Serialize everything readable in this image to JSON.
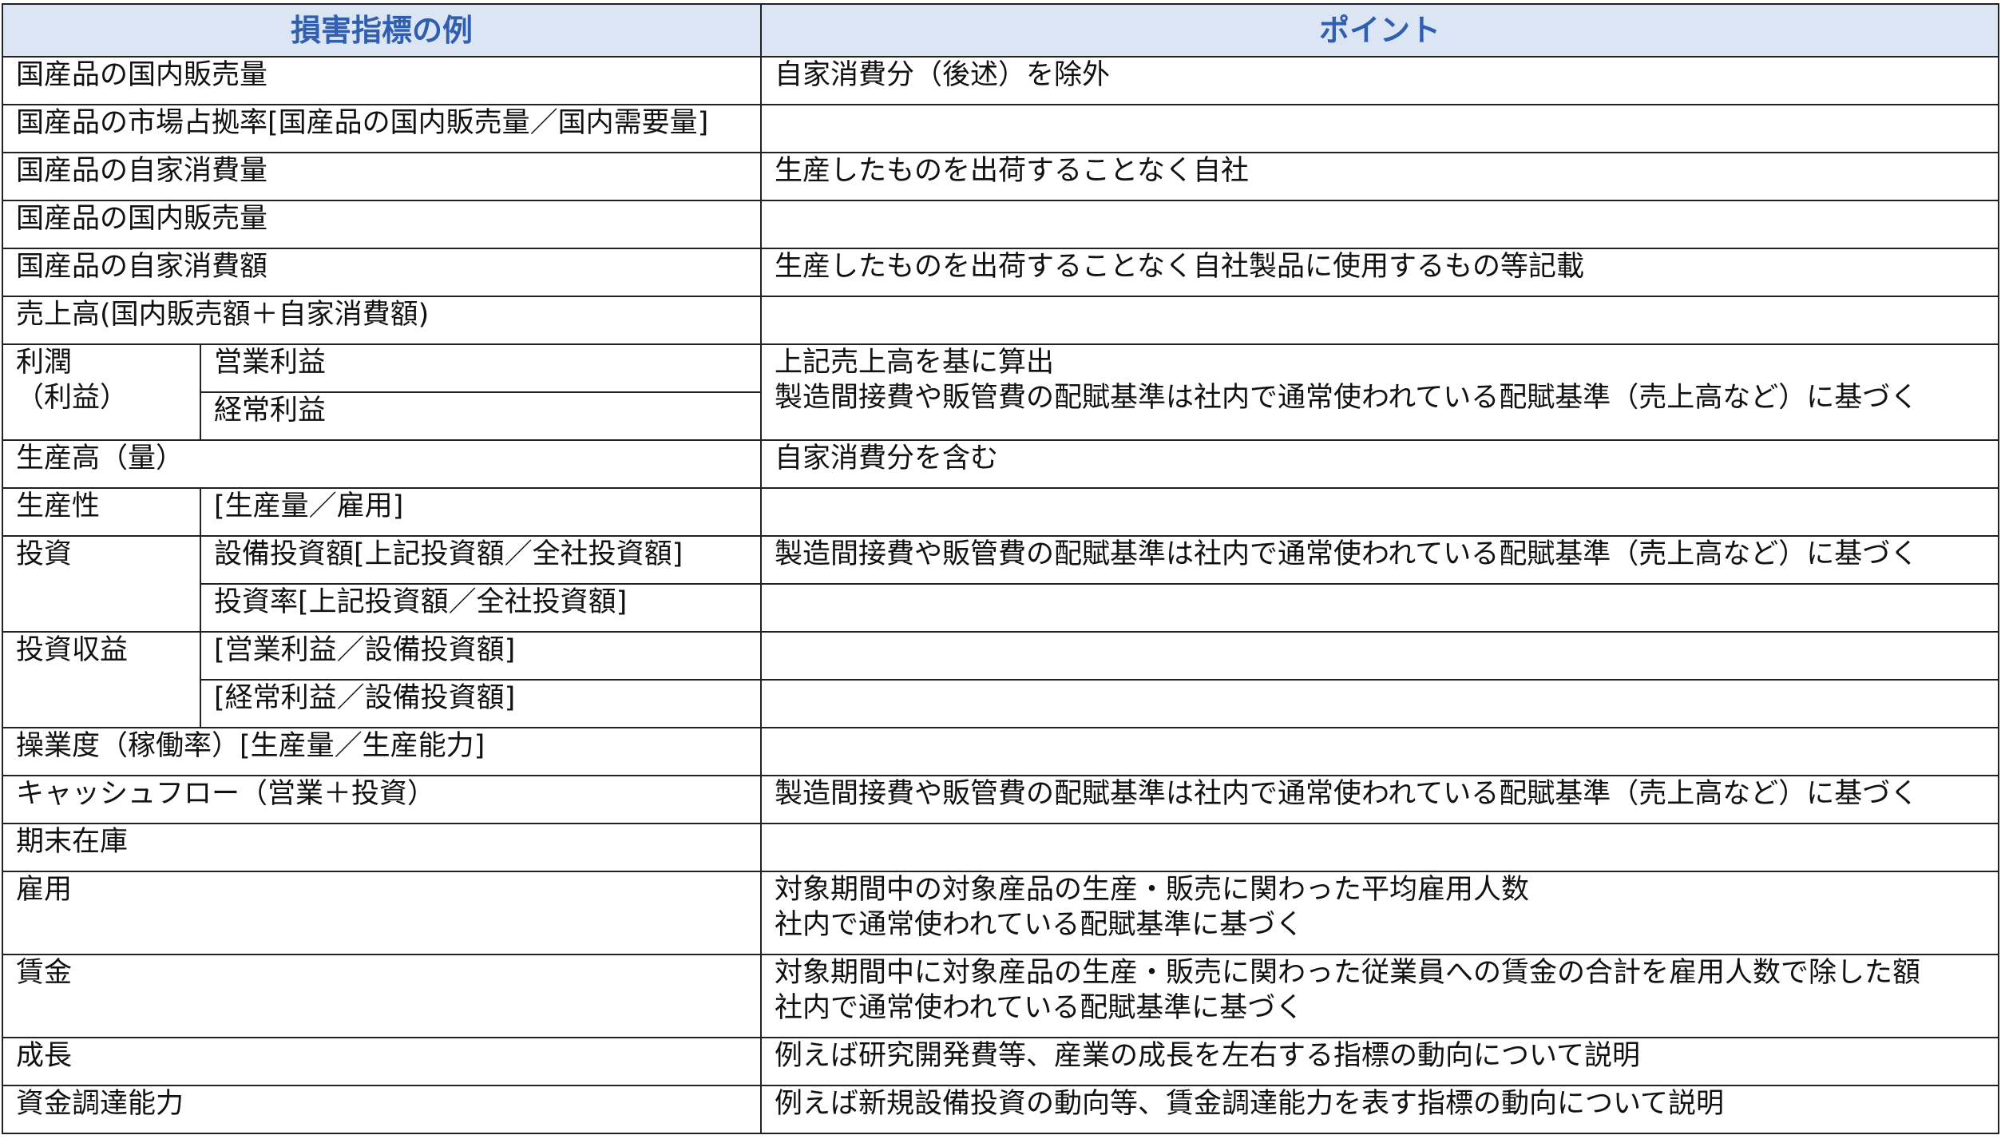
{
  "header": {
    "col_indicator": "損害指標の例",
    "col_point": "ポイント"
  },
  "rows": {
    "domestic_sales_volume": {
      "label": "国産品の国内販売量",
      "point": "自家消費分（後述）を除外"
    },
    "market_share": {
      "label": "国産品の市場占拠率[国産品の国内販売量／国内需要量]",
      "point": ""
    },
    "self_consumption_volume": {
      "label": "国産品の自家消費量",
      "point": "生産したものを出荷することなく自社"
    },
    "domestic_sales_volume_2": {
      "label": "国産品の国内販売量",
      "point": ""
    },
    "self_consumption_amount": {
      "label": "国産品の自家消費額",
      "point": "生産したものを出荷することなく自社製品に使用するもの等記載"
    },
    "sales_total": {
      "label": "売上高(国内販売額＋自家消費額)",
      "point": ""
    },
    "profit": {
      "label_line1": "利潤",
      "label_line2": "（利益）",
      "sub1": "営業利益",
      "sub2": "経常利益",
      "point_line1": "上記売上高を基に算出",
      "point_line2": "製造間接費や販管費の配賦基準は社内で通常使われている配賦基準（売上高など）に基づく"
    },
    "production_output": {
      "label": "生産高（量）",
      "point": "自家消費分を含む"
    },
    "productivity": {
      "label": "生産性",
      "sub": "[生産量／雇用]",
      "point": ""
    },
    "investment": {
      "label": "投資",
      "sub1": "設備投資額[上記投資額／全社投資額]",
      "point1": "製造間接費や販管費の配賦基準は社内で通常使われている配賦基準（売上高など）に基づく",
      "sub2": "投資率[上記投資額／全社投資額]",
      "point2": ""
    },
    "investment_return": {
      "label": "投資収益",
      "sub1": "[営業利益／設備投資額]",
      "point1": "",
      "sub2": "[経常利益／設備投資額]",
      "point2": ""
    },
    "operating_rate": {
      "label": "操業度（稼働率）[生産量／生産能力]",
      "point": ""
    },
    "cash_flow": {
      "label": "キャッシュフロー（営業＋投資）",
      "point": "製造間接費や販管費の配賦基準は社内で通常使われている配賦基準（売上高など）に基づく"
    },
    "inventory": {
      "label": "期末在庫",
      "point": ""
    },
    "employment": {
      "label": "雇用",
      "point_line1": "対象期間中の対象産品の生産・販売に関わった平均雇用人数",
      "point_line2": "社内で通常使われている配賦基準に基づく"
    },
    "wages": {
      "label": "賃金",
      "point_line1": "対象期間中に対象産品の生産・販売に関わった従業員への賃金の合計を雇用人数で除した額",
      "point_line2": "社内で通常使われている配賦基準に基づく"
    },
    "growth": {
      "label": "成長",
      "point": "例えば研究開発費等、産業の成長を左右する指標の動向について説明"
    },
    "capital_raising": {
      "label": "資金調達能力",
      "point": "例えば新規設備投資の動向等、賃金調達能力を表す指標の動向について説明"
    }
  }
}
